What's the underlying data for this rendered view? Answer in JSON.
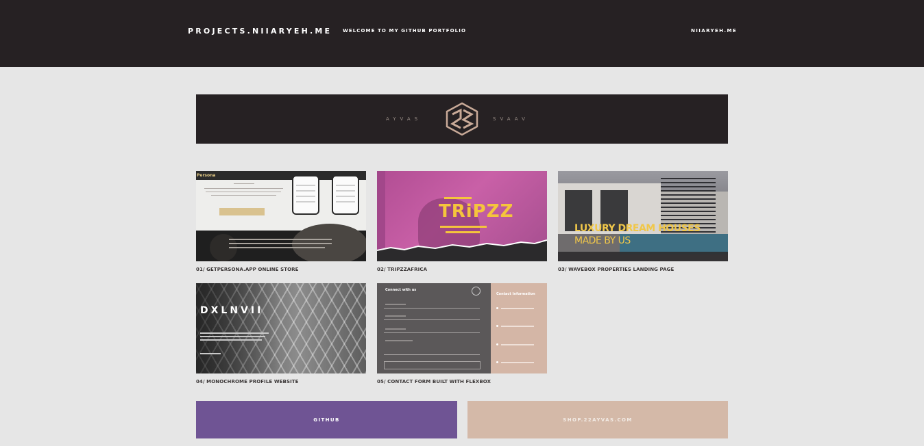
{
  "header": {
    "brand": "PROJECTS.NIIARYEH.ME",
    "tagline": "WELCOME TO MY GITHUB PORTFOLIO",
    "site_link": "NIIARYEH.ME"
  },
  "banner": {
    "left_word": "AYVAS",
    "right_word": "SVAAV",
    "logo_icon": "22ayvas-monogram-icon"
  },
  "projects": [
    {
      "caption": "01/ GETPERSONA.APP ONLINE STORE",
      "thumb": {
        "logo": "Persona"
      }
    },
    {
      "caption": "02/ TRIPZZAFRICA",
      "thumb": {
        "title": "TRiPZZ"
      }
    },
    {
      "caption": "03/ WAVEBOX PROPERTIES LANDING PAGE",
      "thumb": {
        "line1": "LUXURY DREAM HOUSES",
        "line2": "MADE BY US"
      }
    },
    {
      "caption": "04/ MONOCHROME PROFILE WEBSITE",
      "thumb": {
        "title": "DXLNVII"
      }
    },
    {
      "caption": "05/ CONTACT FORM BUILT WITH FLEXBOX",
      "thumb": {
        "left_title": "Connect with us",
        "right_title": "Contact Information"
      }
    }
  ],
  "links": {
    "github": "GITHUB",
    "shop": "SHOP.22AYVAS.COM"
  },
  "colors": {
    "header_bg": "#262123",
    "page_bg": "#e6e6e6",
    "github_btn": "#6f5494",
    "shop_btn": "#d4b9a8"
  }
}
